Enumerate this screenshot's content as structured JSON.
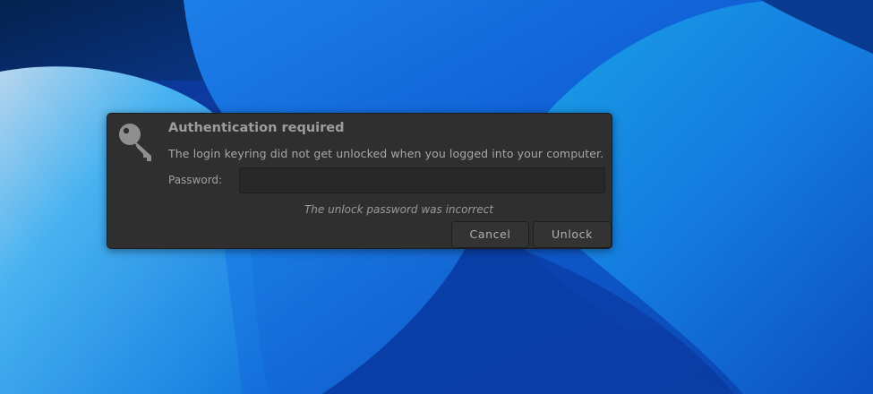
{
  "dialog": {
    "title": "Authentication required",
    "message": "The login keyring did not get unlocked when you logged into your computer.",
    "password_label": "Password:",
    "password_value": "",
    "error_text": "The unlock password was incorrect",
    "cancel_label": "Cancel",
    "unlock_label": "Unlock",
    "icon": "key-icon"
  },
  "colors": {
    "dialog_bg": "#2f2f2f",
    "wallpaper_primary": "#1565d8",
    "wallpaper_dark": "#0a3fa8"
  }
}
